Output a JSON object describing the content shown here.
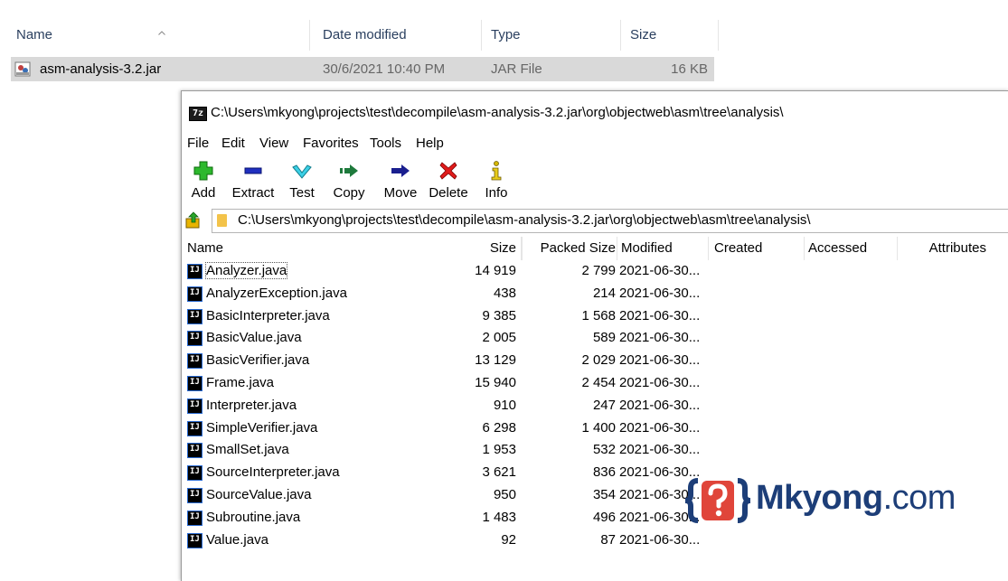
{
  "explorer": {
    "columns": {
      "name": "Name",
      "date": "Date modified",
      "type": "Type",
      "size": "Size"
    },
    "file": {
      "name": "asm-analysis-3.2.jar",
      "date": "30/6/2021 10:40 PM",
      "type": "JAR File",
      "size": "16 KB"
    }
  },
  "sevenzip": {
    "title": "C:\\Users\\mkyong\\projects\\test\\decompile\\asm-analysis-3.2.jar\\org\\objectweb\\asm\\tree\\analysis\\",
    "app_icon_text": "7z",
    "menu": [
      "File",
      "Edit",
      "View",
      "Favorites",
      "Tools",
      "Help"
    ],
    "toolbar": {
      "add": "Add",
      "extract": "Extract",
      "test": "Test",
      "copy": "Copy",
      "move": "Move",
      "delete": "Delete",
      "info": "Info"
    },
    "address": "C:\\Users\\mkyong\\projects\\test\\decompile\\asm-analysis-3.2.jar\\org\\objectweb\\asm\\tree\\analysis\\",
    "columns": {
      "name": "Name",
      "size": "Size",
      "packed": "Packed Size",
      "modified": "Modified",
      "created": "Created",
      "accessed": "Accessed",
      "attributes": "Attributes"
    },
    "file_icon_text": "IJ",
    "files": [
      {
        "name": "Analyzer.java",
        "size": "14 919",
        "packed": "2 799",
        "modified": "2021-06-30..."
      },
      {
        "name": "AnalyzerException.java",
        "size": "438",
        "packed": "214",
        "modified": "2021-06-30..."
      },
      {
        "name": "BasicInterpreter.java",
        "size": "9 385",
        "packed": "1 568",
        "modified": "2021-06-30..."
      },
      {
        "name": "BasicValue.java",
        "size": "2 005",
        "packed": "589",
        "modified": "2021-06-30..."
      },
      {
        "name": "BasicVerifier.java",
        "size": "13 129",
        "packed": "2 029",
        "modified": "2021-06-30..."
      },
      {
        "name": "Frame.java",
        "size": "15 940",
        "packed": "2 454",
        "modified": "2021-06-30..."
      },
      {
        "name": "Interpreter.java",
        "size": "910",
        "packed": "247",
        "modified": "2021-06-30..."
      },
      {
        "name": "SimpleVerifier.java",
        "size": "6 298",
        "packed": "1 400",
        "modified": "2021-06-30..."
      },
      {
        "name": "SmallSet.java",
        "size": "1 953",
        "packed": "532",
        "modified": "2021-06-30..."
      },
      {
        "name": "SourceInterpreter.java",
        "size": "3 621",
        "packed": "836",
        "modified": "2021-06-30..."
      },
      {
        "name": "SourceValue.java",
        "size": "950",
        "packed": "354",
        "modified": "2021-06-30..."
      },
      {
        "name": "Subroutine.java",
        "size": "1 483",
        "packed": "496",
        "modified": "2021-06-30..."
      },
      {
        "name": "Value.java",
        "size": "92",
        "packed": "87",
        "modified": "2021-06-30..."
      }
    ]
  },
  "watermark": {
    "brand": "Mkyong",
    "domain": ".com"
  },
  "colors": {
    "brand": "#1d3e78",
    "accent": "#e0453a",
    "selection": "#d9d9d9"
  }
}
